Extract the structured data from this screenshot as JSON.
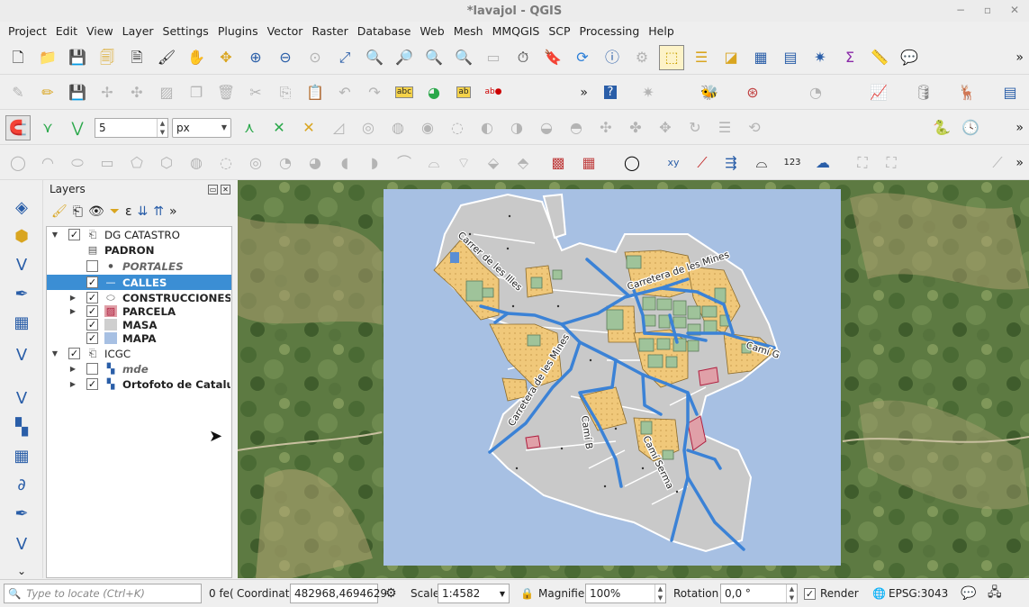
{
  "window": {
    "title": "*lavajol - QGIS"
  },
  "menu": [
    "Project",
    "Edit",
    "View",
    "Layer",
    "Settings",
    "Plugins",
    "Vector",
    "Raster",
    "Database",
    "Web",
    "Mesh",
    "MMQGIS",
    "SCP",
    "Processing",
    "Help"
  ],
  "toolbar": {
    "snap_tolerance": "5",
    "snap_units": "px",
    "more": "»"
  },
  "layers_panel": {
    "title": "Layers",
    "items": [
      {
        "label": "DG CATASTRO",
        "checked": true,
        "group": true
      },
      {
        "label": "PADRON",
        "checked": null
      },
      {
        "label": "PORTALES",
        "checked": false
      },
      {
        "label": "CALLES",
        "checked": true,
        "selected": true
      },
      {
        "label": "CONSTRUCCIONES ...",
        "checked": true
      },
      {
        "label": "PARCELA",
        "checked": true
      },
      {
        "label": "MASA",
        "checked": true
      },
      {
        "label": "MAPA",
        "checked": true
      },
      {
        "label": "ICGC",
        "checked": true,
        "group": true
      },
      {
        "label": "mde",
        "checked": false
      },
      {
        "label": "Ortofoto de Catalu...",
        "checked": true
      }
    ],
    "check_mark": "✓"
  },
  "map": {
    "street_labels": [
      "Carrer de les Illes",
      "Carretera de les Mines",
      "Carretera de les Mines",
      "Camí G",
      "Camí B",
      "Camí Serma"
    ],
    "colors": {
      "water": "#a7c0e3",
      "block": "#c9c9c9",
      "parcel_fill": "#f0c87a",
      "street": "#3b82d6",
      "building": "#9fc39a"
    }
  },
  "statusbar": {
    "search_placeholder": "Type to locate (Ctrl+K)",
    "features": "0 fe(",
    "coordinate_label": "Coordinate",
    "coordinate_value": "482968,4694629",
    "scale_label": "Scale",
    "scale_value": "1:4582",
    "magnifier_label": "Magnifier",
    "magnifier_value": "100%",
    "rotation_label": "Rotation",
    "rotation_value": "0,0 °",
    "render_label": "Render",
    "crs": "EPSG:3043"
  }
}
